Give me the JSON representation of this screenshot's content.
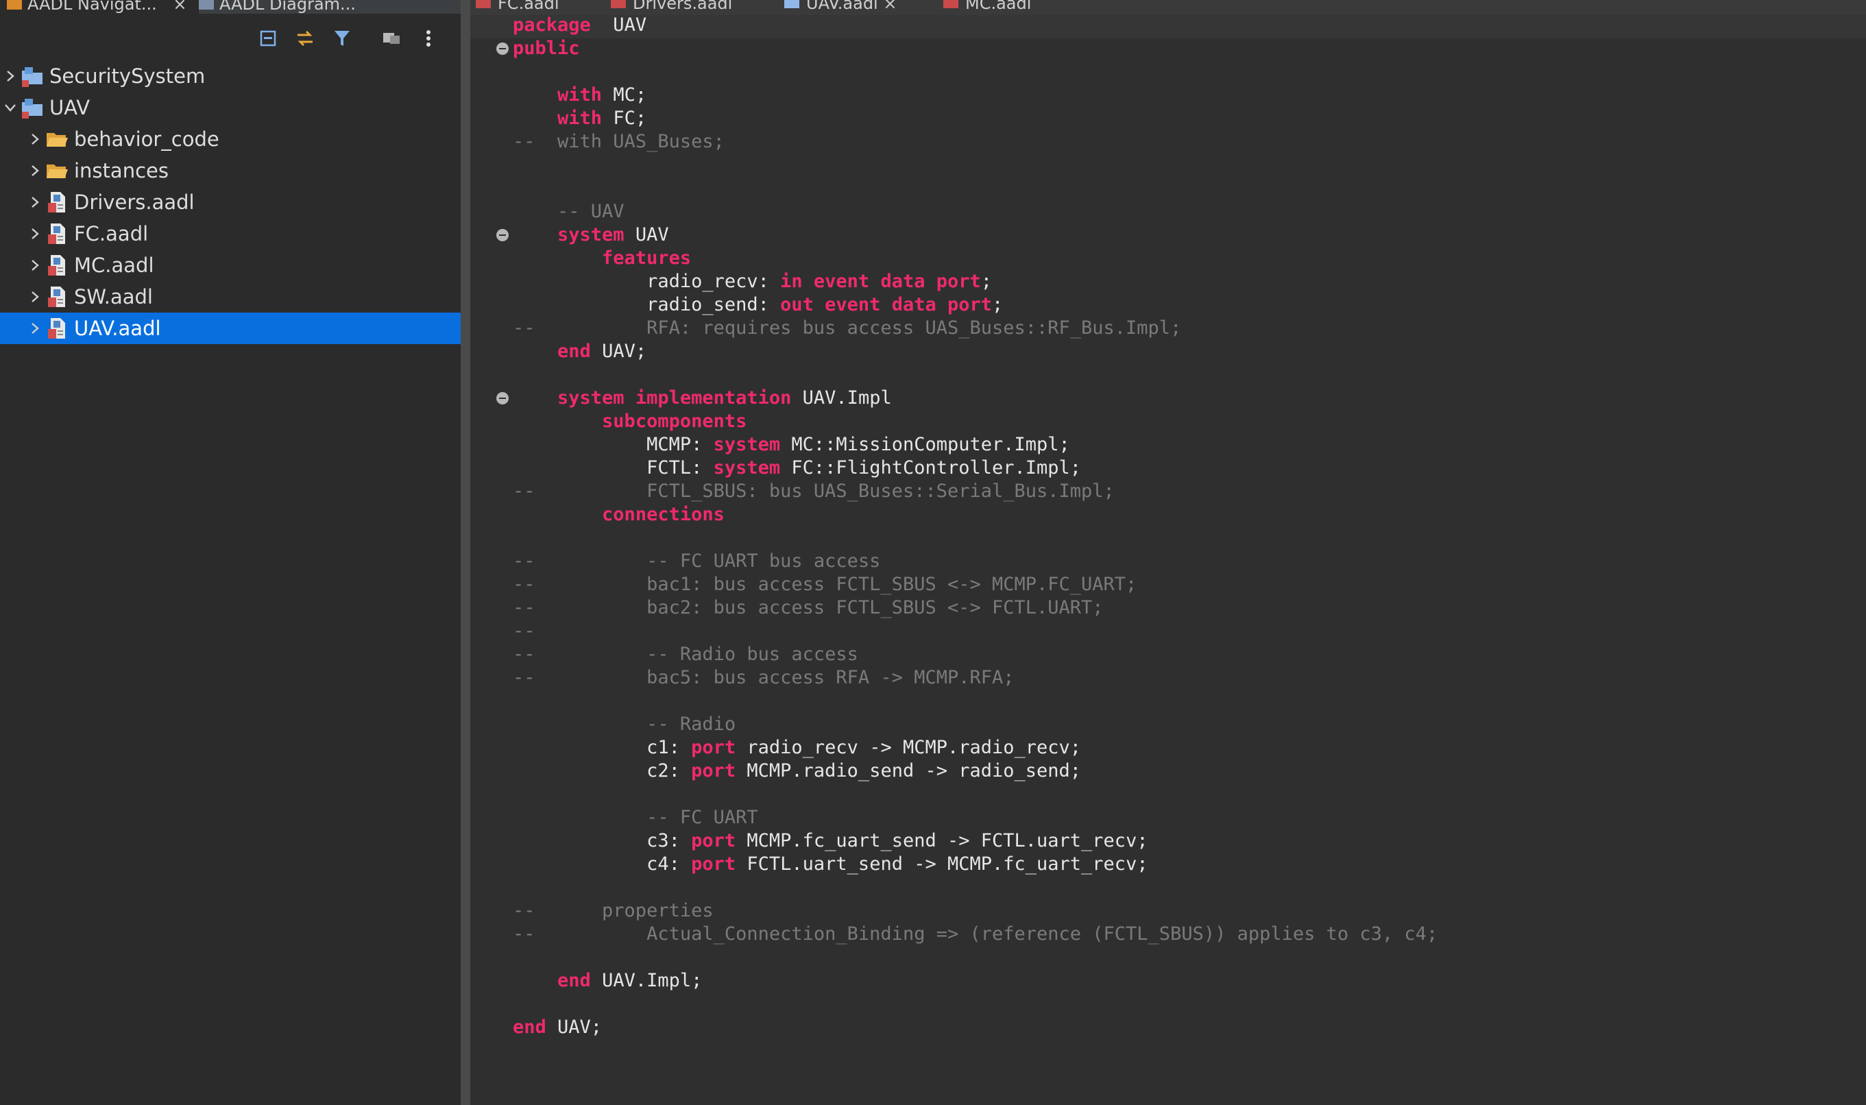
{
  "left_tabs": [
    {
      "label": "AADL Navigat...",
      "close": "×",
      "active": true
    },
    {
      "label": "AADL Diagram...",
      "active": false
    }
  ],
  "toolbar": {
    "icons": [
      "collapse-all-icon",
      "link-with-editor-icon",
      "filter-icon",
      "view-menu-icon",
      "more-options-icon"
    ]
  },
  "tree": {
    "items": [
      {
        "label": "SecuritySystem",
        "level": 0,
        "icon": "project-icon",
        "expanded": false,
        "selected": false
      },
      {
        "label": "UAV",
        "level": 0,
        "icon": "project-icon",
        "expanded": true,
        "selected": false
      },
      {
        "label": "behavior_code",
        "level": 1,
        "icon": "folder-icon",
        "expanded": false,
        "selected": false
      },
      {
        "label": "instances",
        "level": 1,
        "icon": "folder-icon",
        "expanded": false,
        "selected": false
      },
      {
        "label": "Drivers.aadl",
        "level": 1,
        "icon": "aadl-file-icon",
        "expanded": false,
        "selected": false
      },
      {
        "label": "FC.aadl",
        "level": 1,
        "icon": "aadl-file-icon",
        "expanded": false,
        "selected": false
      },
      {
        "label": "MC.aadl",
        "level": 1,
        "icon": "aadl-file-icon",
        "expanded": false,
        "selected": false
      },
      {
        "label": "SW.aadl",
        "level": 1,
        "icon": "aadl-file-icon",
        "expanded": false,
        "selected": false
      },
      {
        "label": "UAV.aadl",
        "level": 1,
        "icon": "aadl-file-icon",
        "expanded": false,
        "selected": true
      }
    ]
  },
  "editor_tabs": [
    {
      "label": "FC.aadl",
      "active": false
    },
    {
      "label": "Drivers.aadl",
      "active": false
    },
    {
      "label": "UAV.aadl",
      "close": "×",
      "active": true
    },
    {
      "label": "MC.aadl",
      "active": false
    }
  ],
  "code": {
    "lines": [
      [
        [
          "kw",
          "package"
        ],
        [
          "",
          "  UAV"
        ]
      ],
      [
        [
          "kw",
          "public"
        ]
      ],
      [],
      [
        [
          "",
          "    "
        ],
        [
          "kw",
          "with"
        ],
        [
          "",
          " MC;"
        ]
      ],
      [
        [
          "",
          "    "
        ],
        [
          "kw",
          "with"
        ],
        [
          "",
          " FC;"
        ]
      ],
      [
        [
          "cm",
          "--  with UAS_Buses;"
        ]
      ],
      [],
      [],
      [
        [
          "cm",
          "    -- UAV"
        ]
      ],
      [
        [
          "",
          "    "
        ],
        [
          "kw",
          "system"
        ],
        [
          "",
          " UAV"
        ]
      ],
      [
        [
          "",
          "        "
        ],
        [
          "kw",
          "features"
        ]
      ],
      [
        [
          "",
          "            radio_recv: "
        ],
        [
          "kw",
          "in event data port"
        ],
        [
          "",
          ";"
        ]
      ],
      [
        [
          "",
          "            radio_send: "
        ],
        [
          "kw",
          "out event data port"
        ],
        [
          "",
          ";"
        ]
      ],
      [
        [
          "cm",
          "--          RFA: requires bus access UAS_Buses::RF_Bus.Impl;"
        ]
      ],
      [
        [
          "",
          "    "
        ],
        [
          "kw",
          "end"
        ],
        [
          "",
          " UAV;"
        ]
      ],
      [],
      [
        [
          "",
          "    "
        ],
        [
          "kw",
          "system implementation"
        ],
        [
          "",
          " UAV.Impl"
        ]
      ],
      [
        [
          "",
          "        "
        ],
        [
          "kw",
          "subcomponents"
        ]
      ],
      [
        [
          "",
          "            MCMP: "
        ],
        [
          "kw",
          "system"
        ],
        [
          "",
          " MC::MissionComputer.Impl;"
        ]
      ],
      [
        [
          "",
          "            FCTL: "
        ],
        [
          "kw",
          "system"
        ],
        [
          "",
          " FC::FlightController.Impl;"
        ]
      ],
      [
        [
          "cm",
          "--          FCTL_SBUS: bus UAS_Buses::Serial_Bus.Impl;"
        ]
      ],
      [
        [
          "",
          "        "
        ],
        [
          "kw",
          "connections"
        ]
      ],
      [],
      [
        [
          "cm",
          "--          -- FC UART bus access"
        ]
      ],
      [
        [
          "cm",
          "--          bac1: bus access FCTL_SBUS <-> MCMP.FC_UART;"
        ]
      ],
      [
        [
          "cm",
          "--          bac2: bus access FCTL_SBUS <-> FCTL.UART;"
        ]
      ],
      [
        [
          "cm",
          "--"
        ]
      ],
      [
        [
          "cm",
          "--          -- Radio bus access"
        ]
      ],
      [
        [
          "cm",
          "--          bac5: bus access RFA -> MCMP.RFA;"
        ]
      ],
      [],
      [
        [
          "cm",
          "            -- Radio"
        ]
      ],
      [
        [
          "",
          "            c1: "
        ],
        [
          "kw",
          "port"
        ],
        [
          "",
          " radio_recv -> MCMP.radio_recv;"
        ]
      ],
      [
        [
          "",
          "            c2: "
        ],
        [
          "kw",
          "port"
        ],
        [
          "",
          " MCMP.radio_send -> radio_send;"
        ]
      ],
      [],
      [
        [
          "cm",
          "            -- FC UART"
        ]
      ],
      [
        [
          "",
          "            c3: "
        ],
        [
          "kw",
          "port"
        ],
        [
          "",
          " MCMP.fc_uart_send -> FCTL.uart_recv;"
        ]
      ],
      [
        [
          "",
          "            c4: "
        ],
        [
          "kw",
          "port"
        ],
        [
          "",
          " FCTL.uart_send -> MCMP.fc_uart_recv;"
        ]
      ],
      [],
      [
        [
          "cm",
          "--      properties"
        ]
      ],
      [
        [
          "cm",
          "--          Actual_Connection_Binding => (reference (FCTL_SBUS)) applies to c3, c4;"
        ]
      ],
      [],
      [
        [
          "",
          "    "
        ],
        [
          "kw",
          "end"
        ],
        [
          "",
          " UAV.Impl;"
        ]
      ],
      [],
      [
        [
          "kw",
          "end"
        ],
        [
          "",
          " UAV;"
        ]
      ]
    ],
    "fold_markers": [
      1,
      9,
      16
    ]
  },
  "colors": {
    "keyword": "#ef2a6b",
    "comment": "#7a7a7a",
    "selection": "#0a6fde",
    "editor_bg": "#2f2f2f"
  }
}
